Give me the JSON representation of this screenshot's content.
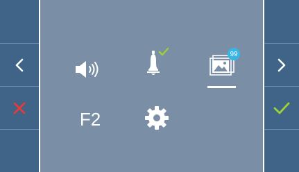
{
  "left_panel": {
    "buttons": [
      {
        "icon": "blank"
      },
      {
        "icon": "chevron-left-icon"
      },
      {
        "icon": "close-icon",
        "color": "#e53a3a"
      },
      {
        "icon": "blank"
      }
    ]
  },
  "right_panel": {
    "buttons": [
      {
        "icon": "blank"
      },
      {
        "icon": "chevron-right-icon"
      },
      {
        "icon": "check-icon",
        "color": "#9bd334"
      },
      {
        "icon": "blank"
      }
    ]
  },
  "menu": {
    "items": [
      {
        "id": "volume",
        "icon": "speaker-volume-icon"
      },
      {
        "id": "alert",
        "icon": "bell-icon",
        "check_color": "#9bd334"
      },
      {
        "id": "gallery",
        "icon": "image-gallery-icon",
        "badge": "99",
        "selected": true
      },
      {
        "id": "f2",
        "label": "F2"
      },
      {
        "id": "settings",
        "icon": "gear-icon"
      }
    ]
  },
  "colors": {
    "side_panel": "#3f6488",
    "center_panel": "#7a8fa5",
    "icon": "#ffffff",
    "badge": "#35b6e6"
  }
}
